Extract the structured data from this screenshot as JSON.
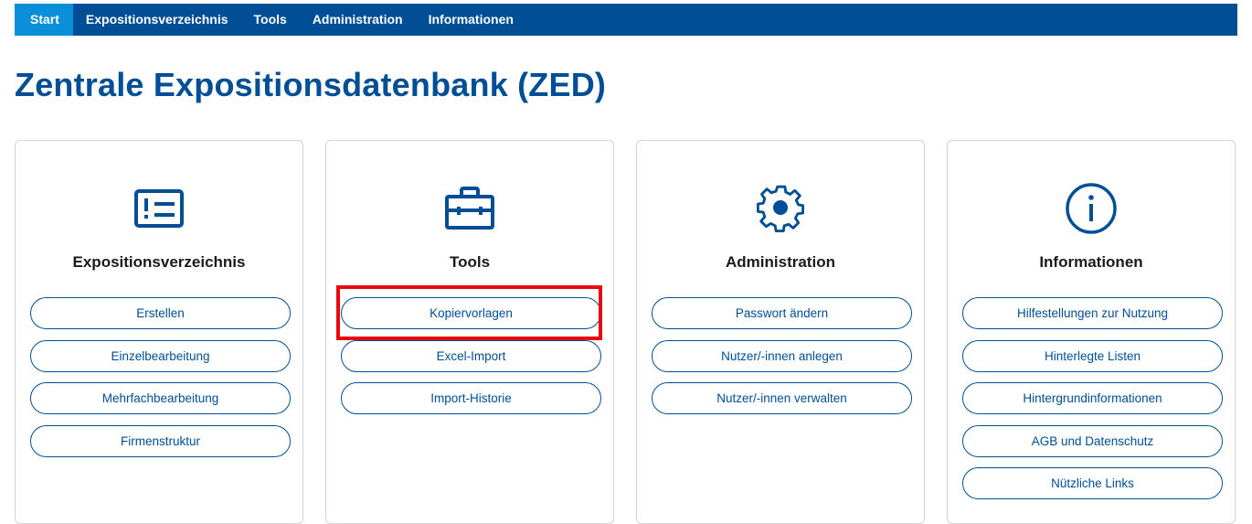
{
  "nav": {
    "items": [
      {
        "label": "Start"
      },
      {
        "label": "Expositionsverzeichnis"
      },
      {
        "label": "Tools"
      },
      {
        "label": "Administration"
      },
      {
        "label": "Informationen"
      }
    ]
  },
  "page": {
    "title": "Zentrale Expositionsdatenbank (ZED)"
  },
  "cards": [
    {
      "icon": "list-exclamation-icon",
      "title": "Expositionsverzeichnis",
      "buttons": [
        "Erstellen",
        "Einzelbearbeitung",
        "Mehrfachbearbeitung",
        "Firmenstruktur"
      ]
    },
    {
      "icon": "toolbox-icon",
      "title": "Tools",
      "buttons": [
        "Kopiervorlagen",
        "Excel-Import",
        "Import-Historie"
      ]
    },
    {
      "icon": "gear-icon",
      "title": "Administration",
      "buttons": [
        "Passwort ändern",
        "Nutzer/-innen anlegen",
        "Nutzer/-innen verwalten"
      ]
    },
    {
      "icon": "info-icon",
      "title": "Informationen",
      "buttons": [
        "Hilfestellungen zur Nutzung",
        "Hinterlegte Listen",
        "Hintergrundinformationen",
        "AGB und Datenschutz",
        "Nützliche Links"
      ]
    }
  ],
  "colors": {
    "brand": "#004e96",
    "active_tab": "#0a8fd8",
    "highlight": "#e8070f"
  }
}
